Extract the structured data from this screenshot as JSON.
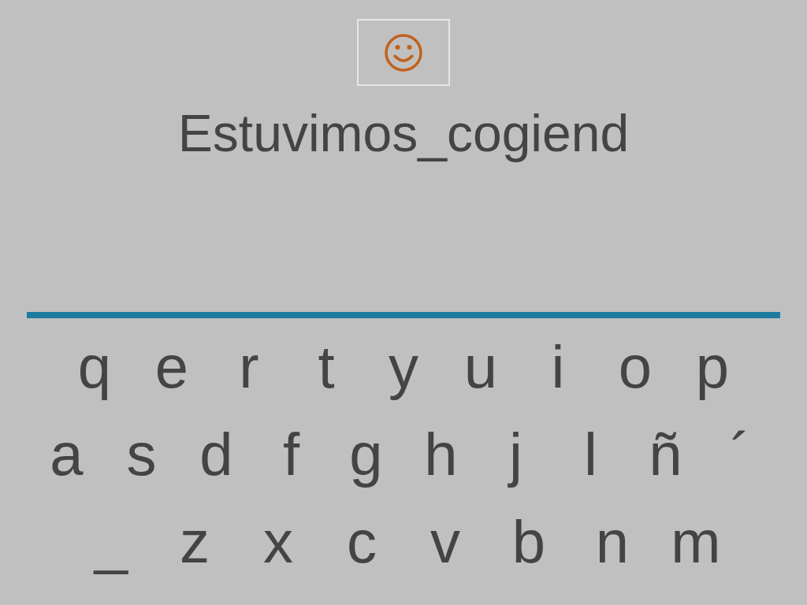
{
  "word": "Estuvimos_cogiend",
  "keyboard": [
    {
      "keys": [
        "q",
        "e",
        "r",
        "t",
        "y",
        "u",
        "i",
        "o",
        "p"
      ]
    },
    {
      "keys": [
        "a",
        "s",
        "d",
        "f",
        "g",
        "h",
        "j",
        "l",
        "ñ",
        "´"
      ]
    },
    {
      "keys": [
        "_",
        "z",
        "x",
        "c",
        "v",
        "b",
        "n",
        "m"
      ]
    }
  ]
}
